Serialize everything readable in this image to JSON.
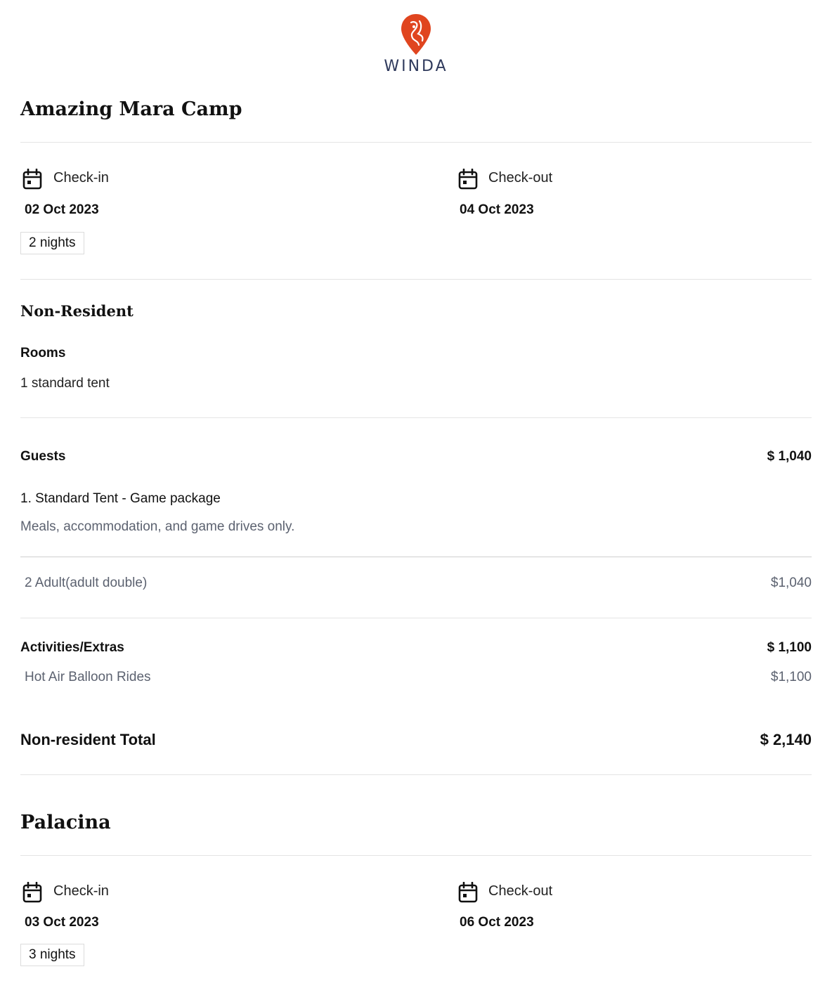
{
  "brand": {
    "name": "WINDA",
    "accent": "#e0451f",
    "text_color": "#2f3a5c"
  },
  "properties": [
    {
      "name": "Amazing Mara Camp",
      "checkin_label": "Check-in",
      "checkin_date": "02 Oct 2023",
      "checkout_label": "Check-out",
      "checkout_date": "04 Oct 2023",
      "nights": "2 nights",
      "residency": "Non-Resident",
      "rooms_label": "Rooms",
      "rooms_value": "1 standard tent",
      "guests_label": "Guests",
      "guests_total": "$ 1,040",
      "package_title": "1. Standard Tent - Game package",
      "package_desc": "Meals, accommodation, and game drives only.",
      "guest_line": "2 Adult(adult double)",
      "guest_line_price": "$1,040",
      "extras_label": "Activities/Extras",
      "extras_total": "$ 1,100",
      "extra_item": "Hot Air Balloon Rides",
      "extra_item_price": "$1,100",
      "total_label": "Non-resident Total",
      "total_value": "$ 2,140"
    },
    {
      "name": "Palacina",
      "checkin_label": "Check-in",
      "checkin_date": "03 Oct 2023",
      "checkout_label": "Check-out",
      "checkout_date": "06 Oct 2023",
      "nights": "3 nights"
    }
  ]
}
